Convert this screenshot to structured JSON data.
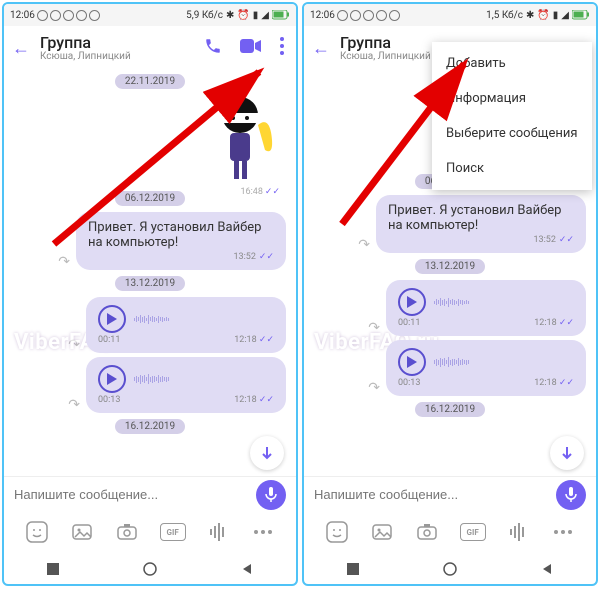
{
  "statusbar": {
    "time": "12:06",
    "net1": "5,9 Кб/с",
    "net2": "1,5 Кб/с"
  },
  "header": {
    "title": "Группа",
    "subtitle": "Ксюша, Липницкий"
  },
  "dates": {
    "d1": "22.11.2019",
    "d2": "06.12.2019",
    "d3": "13.12.2019",
    "d4": "16.12.2019"
  },
  "sticker": {
    "time": "16:48"
  },
  "msg1": {
    "text": "Привет. Я установил Вайбер на компьютер!",
    "time": "13:52"
  },
  "voice1": {
    "dur": "00:11",
    "time": "12:18"
  },
  "voice2": {
    "dur": "00:13",
    "time": "12:18"
  },
  "input": {
    "placeholder": "Напишите сообщение..."
  },
  "menu": {
    "i1": "Добавить",
    "i2": "Информация",
    "i3": "Выберите сообщения",
    "i4": "Поиск"
  },
  "watermark": "ViberFAQ.ru",
  "attach": {
    "gif": "GIF"
  }
}
